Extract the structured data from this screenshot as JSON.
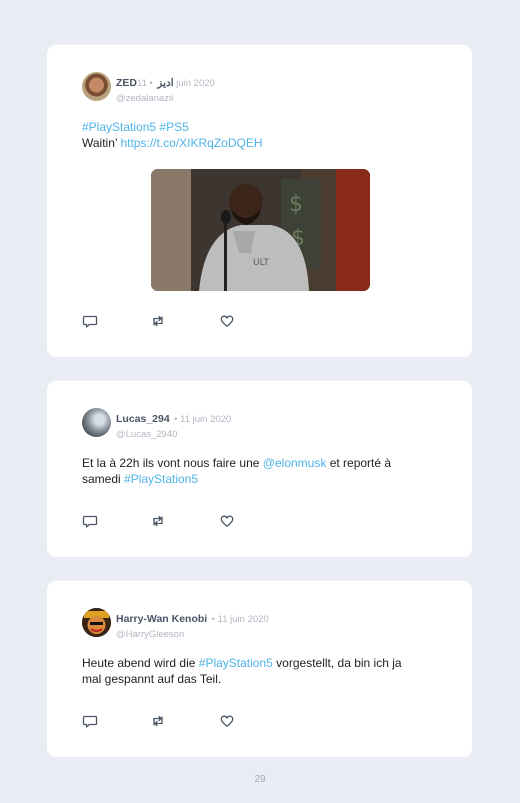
{
  "tweets": [
    {
      "name": "ZEDاديز",
      "date": "• 11 juin 2020",
      "handle": "@zedalanazii",
      "line1_hashtag1": "#PlayStation5",
      "line1_hashtag2": "#PS5",
      "line2_text": "Waitin’",
      "line2_link": "https://t.co/XIKRqZoDQEH",
      "has_media": true
    },
    {
      "name": "Lucas_294",
      "date": "• 11 juin 2020",
      "handle": "@Lucas_2940",
      "t1": "Et la à 22h ils vont nous faire une",
      "mention": "@elonmusk",
      "t2": "et reporté à",
      "t3": "samedi",
      "hashtag": "#PlayStation5"
    },
    {
      "name": "Harry-Wan Kenobi",
      "date": "• 11 juin 2020",
      "handle": "@HarryGleeson",
      "t1": "Heute abend wird die",
      "hashtag": "#PlayStation5",
      "t2": "vorgestellt, da bin ich ja",
      "t3": "mal gespannt auf das Teil."
    }
  ],
  "icons": [
    "reply-icon",
    "retweet-icon",
    "like-icon"
  ],
  "colors": {
    "link": "#4fb3e8",
    "name": "#4a5566",
    "muted": "#b0b6c0",
    "background": "#e9ecf2"
  },
  "page_number": "29"
}
